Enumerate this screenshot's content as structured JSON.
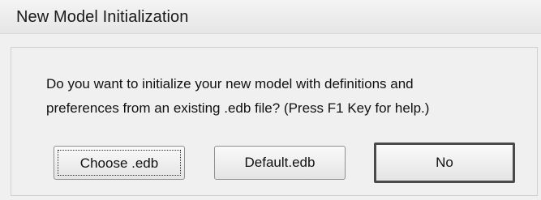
{
  "window": {
    "title": "New Model Initialization"
  },
  "message": {
    "line1": "Do you want to initialize your new model with definitions and",
    "line2": "preferences from an existing .edb file? (Press F1 Key for help.)"
  },
  "buttons": {
    "choose_label": "Choose .edb",
    "default_label": "Default.edb",
    "no_label": "No"
  }
}
